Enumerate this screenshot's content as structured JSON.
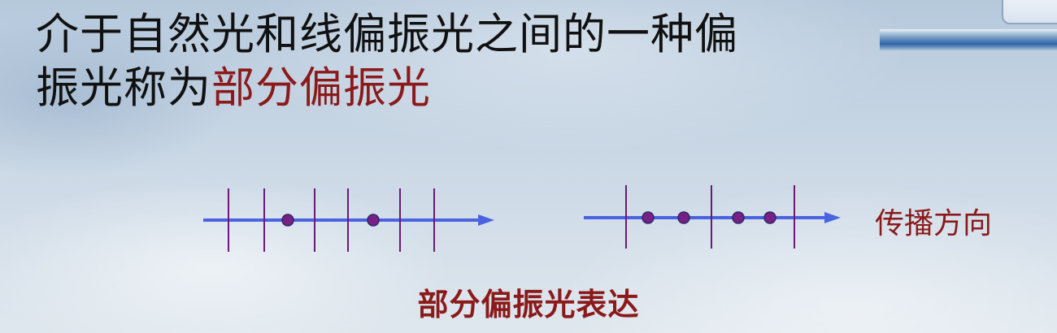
{
  "title": {
    "line1": "介于自然光和线偏振光之间的一种偏",
    "line2_prefix": "振光称为",
    "line2_highlight": "部分偏振光"
  },
  "diagram": {
    "direction_label": "传播方向",
    "caption": "部分偏振光表达",
    "colors": {
      "axis": "#4a63e0",
      "marks": "#6a1a78",
      "dots": "#7a1f86",
      "label": "#8b1a1a"
    },
    "left_beam": {
      "vertical_marks": 6,
      "dots": 2
    },
    "right_beam": {
      "vertical_marks": 3,
      "dots": 4
    }
  }
}
